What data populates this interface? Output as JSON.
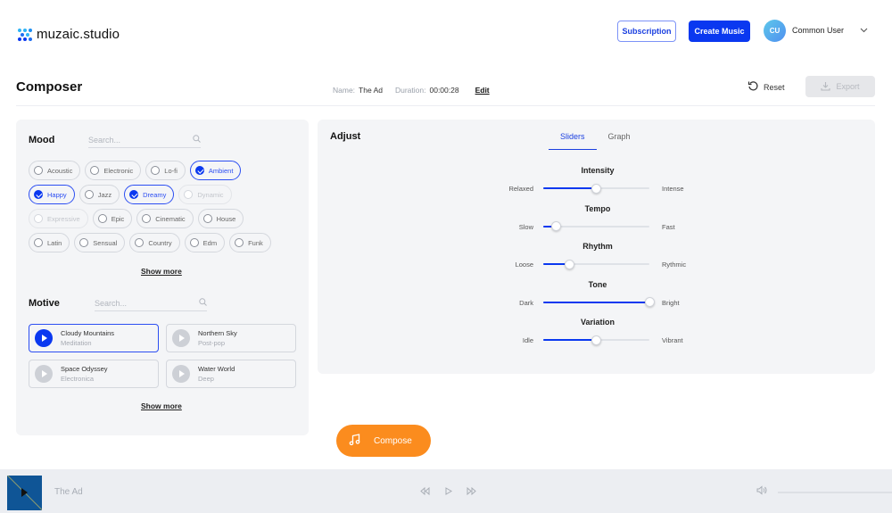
{
  "header": {
    "logo_text": "muzaic.studio",
    "subscription_label": "Subscription",
    "create_music_label": "Create Music",
    "user_initials": "CU",
    "user_name": "Common User",
    "brand_color": "#0a38f0"
  },
  "page": {
    "title": "Composer",
    "name_label": "Name:",
    "name_value": "The Ad",
    "duration_label": "Duration:",
    "duration_value": "00:00:28",
    "edit_label": "Edit",
    "reset_label": "Reset",
    "export_label": "Export"
  },
  "mood": {
    "title": "Mood",
    "search_placeholder": "Search...",
    "chips": [
      {
        "label": "Acoustic",
        "state": "unselected"
      },
      {
        "label": "Electronic",
        "state": "unselected"
      },
      {
        "label": "Lo-fi",
        "state": "unselected"
      },
      {
        "label": "Ambient",
        "state": "selected"
      },
      {
        "label": "Happy",
        "state": "selected"
      },
      {
        "label": "Jazz",
        "state": "unselected"
      },
      {
        "label": "Dreamy",
        "state": "selected"
      },
      {
        "label": "Dynamic",
        "state": "disabled"
      },
      {
        "label": "Expressive",
        "state": "disabled"
      },
      {
        "label": "Epic",
        "state": "unselected"
      },
      {
        "label": "Cinematic",
        "state": "unselected"
      },
      {
        "label": "House",
        "state": "unselected"
      },
      {
        "label": "Latin",
        "state": "unselected"
      },
      {
        "label": "Sensual",
        "state": "unselected"
      },
      {
        "label": "Country",
        "state": "unselected"
      },
      {
        "label": "Edm",
        "state": "unselected"
      },
      {
        "label": "Funk",
        "state": "unselected"
      }
    ],
    "show_more_label": "Show more"
  },
  "motive": {
    "title": "Motive",
    "search_placeholder": "Search...",
    "items": [
      {
        "title": "Cloudy Mountains",
        "subtitle": "Meditation",
        "selected": true
      },
      {
        "title": "Northern Sky",
        "subtitle": "Post-pop",
        "selected": false
      },
      {
        "title": "Space Odyssey",
        "subtitle": "Electronica",
        "selected": false
      },
      {
        "title": "Water World",
        "subtitle": "Deep",
        "selected": false
      }
    ],
    "show_more_label": "Show more"
  },
  "adjust": {
    "title": "Adjust",
    "tabs": [
      {
        "label": "Sliders",
        "active": true
      },
      {
        "label": "Graph",
        "active": false
      }
    ],
    "sliders": [
      {
        "name": "Intensity",
        "low": "Relaxed",
        "high": "Intense",
        "value": 0.5
      },
      {
        "name": "Tempo",
        "low": "Slow",
        "high": "Fast",
        "value": 0.12
      },
      {
        "name": "Rhythm",
        "low": "Loose",
        "high": "Rythmic",
        "value": 0.25
      },
      {
        "name": "Tone",
        "low": "Dark",
        "high": "Bright",
        "value": 1.0
      },
      {
        "name": "Variation",
        "low": "Idle",
        "high": "Vibrant",
        "value": 0.5
      }
    ]
  },
  "compose_label": "Compose",
  "compose_color": "#fb8c1e",
  "player": {
    "track_title": "The Ad",
    "icons": [
      "rewind-icon",
      "play-icon",
      "fast-forward-icon",
      "volume-icon"
    ]
  }
}
